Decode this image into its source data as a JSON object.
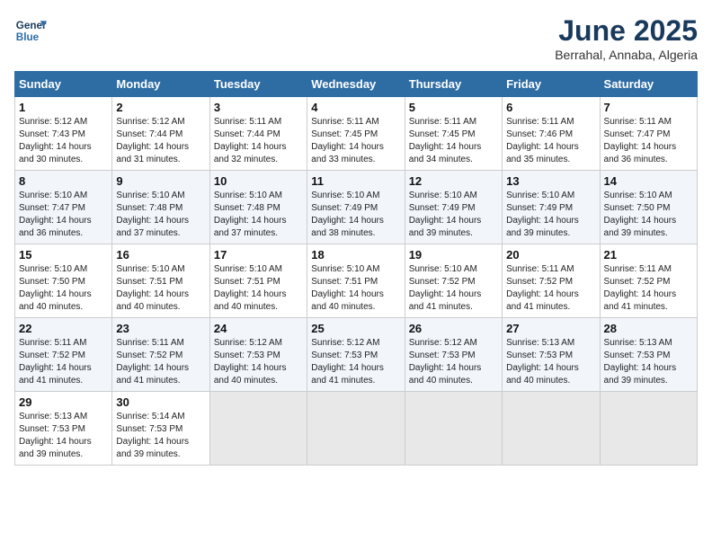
{
  "header": {
    "logo_line1": "General",
    "logo_line2": "Blue",
    "month": "June 2025",
    "location": "Berrahal, Annaba, Algeria"
  },
  "weekdays": [
    "Sunday",
    "Monday",
    "Tuesday",
    "Wednesday",
    "Thursday",
    "Friday",
    "Saturday"
  ],
  "weeks": [
    [
      {
        "day": "1",
        "sunrise": "5:12 AM",
        "sunset": "7:43 PM",
        "daylight": "14 hours and 30 minutes."
      },
      {
        "day": "2",
        "sunrise": "5:12 AM",
        "sunset": "7:44 PM",
        "daylight": "14 hours and 31 minutes."
      },
      {
        "day": "3",
        "sunrise": "5:11 AM",
        "sunset": "7:44 PM",
        "daylight": "14 hours and 32 minutes."
      },
      {
        "day": "4",
        "sunrise": "5:11 AM",
        "sunset": "7:45 PM",
        "daylight": "14 hours and 33 minutes."
      },
      {
        "day": "5",
        "sunrise": "5:11 AM",
        "sunset": "7:45 PM",
        "daylight": "14 hours and 34 minutes."
      },
      {
        "day": "6",
        "sunrise": "5:11 AM",
        "sunset": "7:46 PM",
        "daylight": "14 hours and 35 minutes."
      },
      {
        "day": "7",
        "sunrise": "5:11 AM",
        "sunset": "7:47 PM",
        "daylight": "14 hours and 36 minutes."
      }
    ],
    [
      {
        "day": "8",
        "sunrise": "5:10 AM",
        "sunset": "7:47 PM",
        "daylight": "14 hours and 36 minutes."
      },
      {
        "day": "9",
        "sunrise": "5:10 AM",
        "sunset": "7:48 PM",
        "daylight": "14 hours and 37 minutes."
      },
      {
        "day": "10",
        "sunrise": "5:10 AM",
        "sunset": "7:48 PM",
        "daylight": "14 hours and 37 minutes."
      },
      {
        "day": "11",
        "sunrise": "5:10 AM",
        "sunset": "7:49 PM",
        "daylight": "14 hours and 38 minutes."
      },
      {
        "day": "12",
        "sunrise": "5:10 AM",
        "sunset": "7:49 PM",
        "daylight": "14 hours and 39 minutes."
      },
      {
        "day": "13",
        "sunrise": "5:10 AM",
        "sunset": "7:49 PM",
        "daylight": "14 hours and 39 minutes."
      },
      {
        "day": "14",
        "sunrise": "5:10 AM",
        "sunset": "7:50 PM",
        "daylight": "14 hours and 39 minutes."
      }
    ],
    [
      {
        "day": "15",
        "sunrise": "5:10 AM",
        "sunset": "7:50 PM",
        "daylight": "14 hours and 40 minutes."
      },
      {
        "day": "16",
        "sunrise": "5:10 AM",
        "sunset": "7:51 PM",
        "daylight": "14 hours and 40 minutes."
      },
      {
        "day": "17",
        "sunrise": "5:10 AM",
        "sunset": "7:51 PM",
        "daylight": "14 hours and 40 minutes."
      },
      {
        "day": "18",
        "sunrise": "5:10 AM",
        "sunset": "7:51 PM",
        "daylight": "14 hours and 40 minutes."
      },
      {
        "day": "19",
        "sunrise": "5:10 AM",
        "sunset": "7:52 PM",
        "daylight": "14 hours and 41 minutes."
      },
      {
        "day": "20",
        "sunrise": "5:11 AM",
        "sunset": "7:52 PM",
        "daylight": "14 hours and 41 minutes."
      },
      {
        "day": "21",
        "sunrise": "5:11 AM",
        "sunset": "7:52 PM",
        "daylight": "14 hours and 41 minutes."
      }
    ],
    [
      {
        "day": "22",
        "sunrise": "5:11 AM",
        "sunset": "7:52 PM",
        "daylight": "14 hours and 41 minutes."
      },
      {
        "day": "23",
        "sunrise": "5:11 AM",
        "sunset": "7:52 PM",
        "daylight": "14 hours and 41 minutes."
      },
      {
        "day": "24",
        "sunrise": "5:12 AM",
        "sunset": "7:53 PM",
        "daylight": "14 hours and 40 minutes."
      },
      {
        "day": "25",
        "sunrise": "5:12 AM",
        "sunset": "7:53 PM",
        "daylight": "14 hours and 41 minutes."
      },
      {
        "day": "26",
        "sunrise": "5:12 AM",
        "sunset": "7:53 PM",
        "daylight": "14 hours and 40 minutes."
      },
      {
        "day": "27",
        "sunrise": "5:13 AM",
        "sunset": "7:53 PM",
        "daylight": "14 hours and 40 minutes."
      },
      {
        "day": "28",
        "sunrise": "5:13 AM",
        "sunset": "7:53 PM",
        "daylight": "14 hours and 39 minutes."
      }
    ],
    [
      {
        "day": "29",
        "sunrise": "5:13 AM",
        "sunset": "7:53 PM",
        "daylight": "14 hours and 39 minutes."
      },
      {
        "day": "30",
        "sunrise": "5:14 AM",
        "sunset": "7:53 PM",
        "daylight": "14 hours and 39 minutes."
      },
      null,
      null,
      null,
      null,
      null
    ]
  ]
}
